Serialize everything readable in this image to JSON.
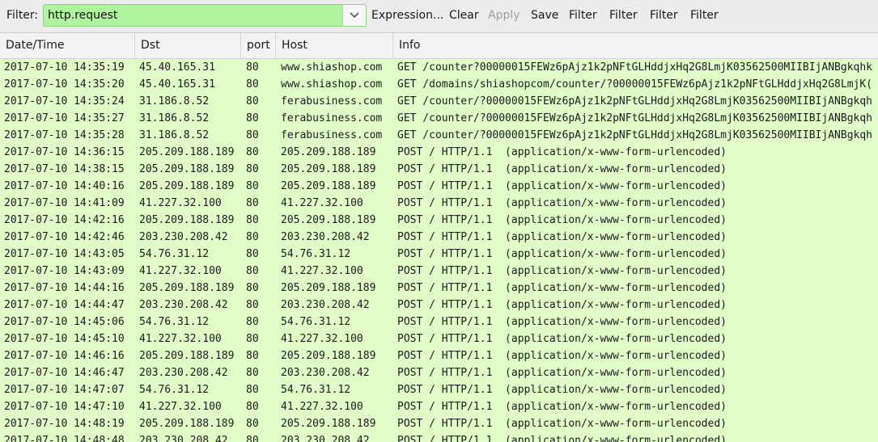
{
  "toolbar": {
    "filter_label": "Filter:",
    "filter_value": "http.request",
    "expression_label": "Expression...",
    "clear_label": "Clear",
    "apply_label": "Apply",
    "save_label": "Save",
    "filter_btn_1": "Filter",
    "filter_btn_2": "Filter",
    "filter_btn_3": "Filter",
    "filter_btn_4": "Filter",
    "dropdown_icon": "chevron-down-icon"
  },
  "columns": {
    "time": "Date/Time",
    "dst": "Dst",
    "port": "port",
    "host": "Host",
    "info": "Info"
  },
  "colors": {
    "filter_valid_bg": "#aff5a0",
    "row_http_bg": "#e1fcc6"
  },
  "rows": [
    {
      "time": "2017-07-10 14:35:19",
      "dst": "45.40.165.31",
      "port": "80",
      "host": "www.shiashop.com",
      "info": "GET /counter?00000015FEWz6pAjz1k2pNFtGLHddjxHq2G8LmjK03562500MIIBIjANBgkqhk"
    },
    {
      "time": "2017-07-10 14:35:20",
      "dst": "45.40.165.31",
      "port": "80",
      "host": "www.shiashop.com",
      "info": "GET /domains/shiashopcom/counter/?00000015FEWz6pAjz1k2pNFtGLHddjxHq2G8LmjK("
    },
    {
      "time": "2017-07-10 14:35:24",
      "dst": "31.186.8.52",
      "port": "80",
      "host": "ferabusiness.com",
      "info": "GET /counter/?00000015FEWz6pAjz1k2pNFtGLHddjxHq2G8LmjK03562500MIIBIjANBgkqh"
    },
    {
      "time": "2017-07-10 14:35:27",
      "dst": "31.186.8.52",
      "port": "80",
      "host": "ferabusiness.com",
      "info": "GET /counter/?00000015FEWz6pAjz1k2pNFtGLHddjxHq2G8LmjK03562500MIIBIjANBgkqh"
    },
    {
      "time": "2017-07-10 14:35:28",
      "dst": "31.186.8.52",
      "port": "80",
      "host": "ferabusiness.com",
      "info": "GET /counter/?00000015FEWz6pAjz1k2pNFtGLHddjxHq2G8LmjK03562500MIIBIjANBgkqh"
    },
    {
      "time": "2017-07-10 14:36:15",
      "dst": "205.209.188.189",
      "port": "80",
      "host": "205.209.188.189",
      "info": "POST / HTTP/1.1  (application/x-www-form-urlencoded)"
    },
    {
      "time": "2017-07-10 14:38:15",
      "dst": "205.209.188.189",
      "port": "80",
      "host": "205.209.188.189",
      "info": "POST / HTTP/1.1  (application/x-www-form-urlencoded)"
    },
    {
      "time": "2017-07-10 14:40:16",
      "dst": "205.209.188.189",
      "port": "80",
      "host": "205.209.188.189",
      "info": "POST / HTTP/1.1  (application/x-www-form-urlencoded)"
    },
    {
      "time": "2017-07-10 14:41:09",
      "dst": "41.227.32.100",
      "port": "80",
      "host": "41.227.32.100",
      "info": "POST / HTTP/1.1  (application/x-www-form-urlencoded)"
    },
    {
      "time": "2017-07-10 14:42:16",
      "dst": "205.209.188.189",
      "port": "80",
      "host": "205.209.188.189",
      "info": "POST / HTTP/1.1  (application/x-www-form-urlencoded)"
    },
    {
      "time": "2017-07-10 14:42:46",
      "dst": "203.230.208.42",
      "port": "80",
      "host": "203.230.208.42",
      "info": "POST / HTTP/1.1  (application/x-www-form-urlencoded)"
    },
    {
      "time": "2017-07-10 14:43:05",
      "dst": "54.76.31.12",
      "port": "80",
      "host": "54.76.31.12",
      "info": "POST / HTTP/1.1  (application/x-www-form-urlencoded)"
    },
    {
      "time": "2017-07-10 14:43:09",
      "dst": "41.227.32.100",
      "port": "80",
      "host": "41.227.32.100",
      "info": "POST / HTTP/1.1  (application/x-www-form-urlencoded)"
    },
    {
      "time": "2017-07-10 14:44:16",
      "dst": "205.209.188.189",
      "port": "80",
      "host": "205.209.188.189",
      "info": "POST / HTTP/1.1  (application/x-www-form-urlencoded)"
    },
    {
      "time": "2017-07-10 14:44:47",
      "dst": "203.230.208.42",
      "port": "80",
      "host": "203.230.208.42",
      "info": "POST / HTTP/1.1  (application/x-www-form-urlencoded)"
    },
    {
      "time": "2017-07-10 14:45:06",
      "dst": "54.76.31.12",
      "port": "80",
      "host": "54.76.31.12",
      "info": "POST / HTTP/1.1  (application/x-www-form-urlencoded)"
    },
    {
      "time": "2017-07-10 14:45:10",
      "dst": "41.227.32.100",
      "port": "80",
      "host": "41.227.32.100",
      "info": "POST / HTTP/1.1  (application/x-www-form-urlencoded)"
    },
    {
      "time": "2017-07-10 14:46:16",
      "dst": "205.209.188.189",
      "port": "80",
      "host": "205.209.188.189",
      "info": "POST / HTTP/1.1  (application/x-www-form-urlencoded)"
    },
    {
      "time": "2017-07-10 14:46:47",
      "dst": "203.230.208.42",
      "port": "80",
      "host": "203.230.208.42",
      "info": "POST / HTTP/1.1  (application/x-www-form-urlencoded)"
    },
    {
      "time": "2017-07-10 14:47:07",
      "dst": "54.76.31.12",
      "port": "80",
      "host": "54.76.31.12",
      "info": "POST / HTTP/1.1  (application/x-www-form-urlencoded)"
    },
    {
      "time": "2017-07-10 14:47:10",
      "dst": "41.227.32.100",
      "port": "80",
      "host": "41.227.32.100",
      "info": "POST / HTTP/1.1  (application/x-www-form-urlencoded)"
    },
    {
      "time": "2017-07-10 14:48:19",
      "dst": "205.209.188.189",
      "port": "80",
      "host": "205.209.188.189",
      "info": "POST / HTTP/1.1  (application/x-www-form-urlencoded)"
    },
    {
      "time": "2017-07-10 14:48:48",
      "dst": "203.230.208.42",
      "port": "80",
      "host": "203.230.208.42",
      "info": "POST / HTTP/1.1  (application/x-www-form-urlencoded)"
    }
  ]
}
